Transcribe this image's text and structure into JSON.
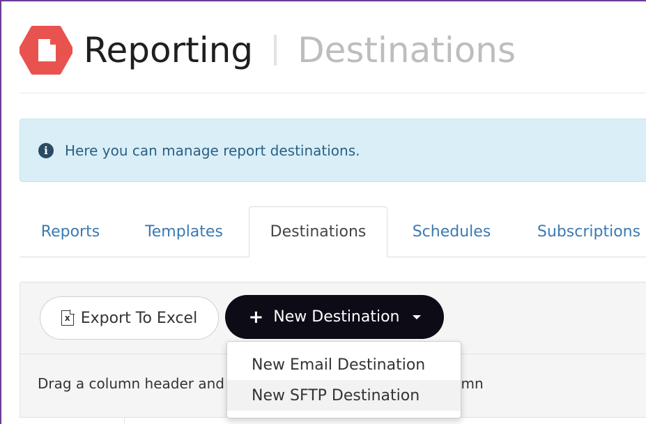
{
  "header": {
    "title": "Reporting",
    "subtitle": "Destinations",
    "logo_icon": "document-hexagon-icon",
    "logo_color": "#e8534f"
  },
  "alert": {
    "icon": "info-icon",
    "text": "Here you can manage report destinations."
  },
  "tabs": [
    {
      "label": "Reports",
      "active": false
    },
    {
      "label": "Templates",
      "active": false
    },
    {
      "label": "Destinations",
      "active": true
    },
    {
      "label": "Schedules",
      "active": false
    },
    {
      "label": "Subscriptions",
      "active": false
    }
  ],
  "toolbar": {
    "export_label": "Export To Excel",
    "new_label": "New Destination"
  },
  "menu": {
    "items": [
      {
        "label": "New Email Destination"
      },
      {
        "label": "New SFTP Destination"
      }
    ]
  },
  "grid": {
    "group_hint": "Drag a column header and drop it here to group by that column"
  },
  "colors": {
    "accent": "#3a79b3",
    "primary_button": "#0c0b16",
    "alert_bg": "#d9eef6"
  }
}
